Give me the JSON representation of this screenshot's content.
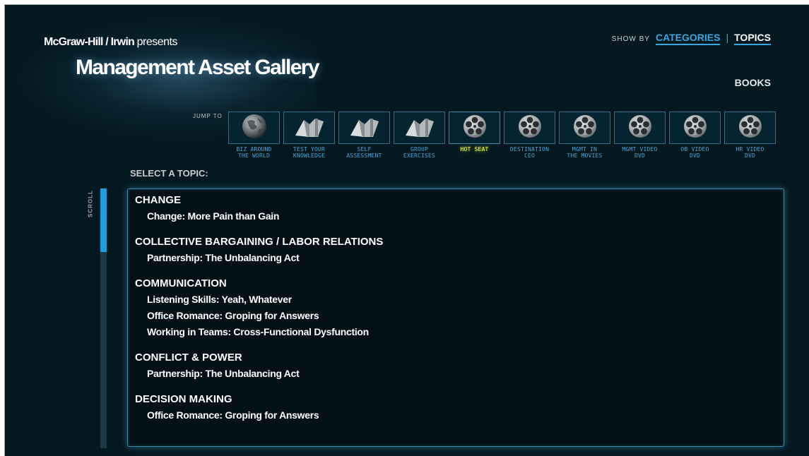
{
  "header": {
    "brand_bold": "McGraw-Hill / Irwin",
    "brand_tail": "presents",
    "title": "Management Asset Gallery"
  },
  "showby": {
    "label": "SHOW BY",
    "categories": "CATEGORIES",
    "separator": "|",
    "topics": "TOPICS"
  },
  "books": "BOOKS",
  "jump": {
    "label": "JUMP TO",
    "items": [
      {
        "label": "BIZ AROUND\nTHE WORLD",
        "icon": "globe"
      },
      {
        "label": "TEST YOUR\nKNOWLEDGE",
        "icon": "book"
      },
      {
        "label": "SELF\nASSESSMENT",
        "icon": "book"
      },
      {
        "label": "GROUP\nEXERCISES",
        "icon": "book"
      },
      {
        "label": "HOT SEAT",
        "icon": "film-reel",
        "active": true
      },
      {
        "label": "DESTINATION\nCEO",
        "icon": "film-reel"
      },
      {
        "label": "MGMT IN\nTHE MOVIES",
        "icon": "film-reel"
      },
      {
        "label": "MGMT VIDEO\nDVD",
        "icon": "film-reel"
      },
      {
        "label": "OB VIDEO\nDVD",
        "icon": "film-reel"
      },
      {
        "label": "HR VIDEO\nDVD",
        "icon": "film-reel"
      }
    ]
  },
  "select_label": "SELECT A TOPIC:",
  "scroll_label": "SCROLL",
  "scroll_position": 0.0,
  "topics": [
    {
      "heading": "CHANGE",
      "items": [
        "Change: More Pain than Gain"
      ]
    },
    {
      "heading": "COLLECTIVE BARGAINING / LABOR RELATIONS",
      "items": [
        "Partnership: The Unbalancing Act"
      ]
    },
    {
      "heading": "COMMUNICATION",
      "items": [
        "Listening Skills: Yeah, Whatever",
        "Office Romance: Groping for Answers",
        "Working in Teams: Cross-Functional Dysfunction"
      ]
    },
    {
      "heading": "CONFLICT & POWER",
      "items": [
        "Partnership: The Unbalancing Act"
      ]
    },
    {
      "heading": "DECISION MAKING",
      "items": [
        "Office Romance: Groping for Answers"
      ]
    }
  ],
  "colors": {
    "background": "#041820",
    "accent": "#3aa6e0",
    "active_label": "#ffff66"
  }
}
